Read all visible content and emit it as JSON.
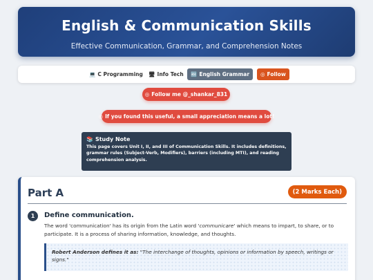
{
  "header": {
    "title": "English & Communication Skills",
    "subtitle": "Effective Communication, Grammar, and Comprehension Notes"
  },
  "nav": {
    "items": [
      {
        "icon": "💻",
        "label": "C Programming"
      },
      {
        "icon": "🖥",
        "label": "Info Tech"
      },
      {
        "icon": "🔤",
        "label": "English Grammar"
      }
    ],
    "follow": {
      "icon": "◎",
      "label": "Follow"
    }
  },
  "social": {
    "follow_pill": {
      "icon": "◎",
      "label": "Follow me @_shankar_831"
    },
    "appreciation_pill": {
      "icon": "◎",
      "label": "If you found this useful, a small appreciation means a lot!"
    }
  },
  "study_note": {
    "icon": "📚",
    "title": "Study Note",
    "text": "This page covers Unit I, II, and III of Communication Skills. It includes definitions, grammar rules (Subject-Verb, Modifiers), barriers (including MTI), and reading comprehension analysis."
  },
  "part": {
    "title": "Part A",
    "marks": "(2 Marks Each)",
    "questions": [
      {
        "number": "1",
        "title": "Define communication.",
        "body_pre": "The word 'communication' has its origin from the Latin word ",
        "body_em": "'communicare'",
        "body_post": " which means to impart, to share, or to participate. It is a process of sharing information, knowledge, and thoughts.",
        "quote_lead": "Robert Anderson defines it as:",
        "quote_text": " \"The interchange of thoughts, opinions or information by speech, writings or signs.\""
      }
    ]
  },
  "colors": {
    "header_gradient": [
      "#1f3f7a",
      "#2a5298"
    ],
    "active_nav": "#5f6f82",
    "follow_orange": "#d9541e",
    "pill_red": "#e04b3f",
    "note_bg": "#2e3e52",
    "marks_badge": "#e05a0e"
  }
}
